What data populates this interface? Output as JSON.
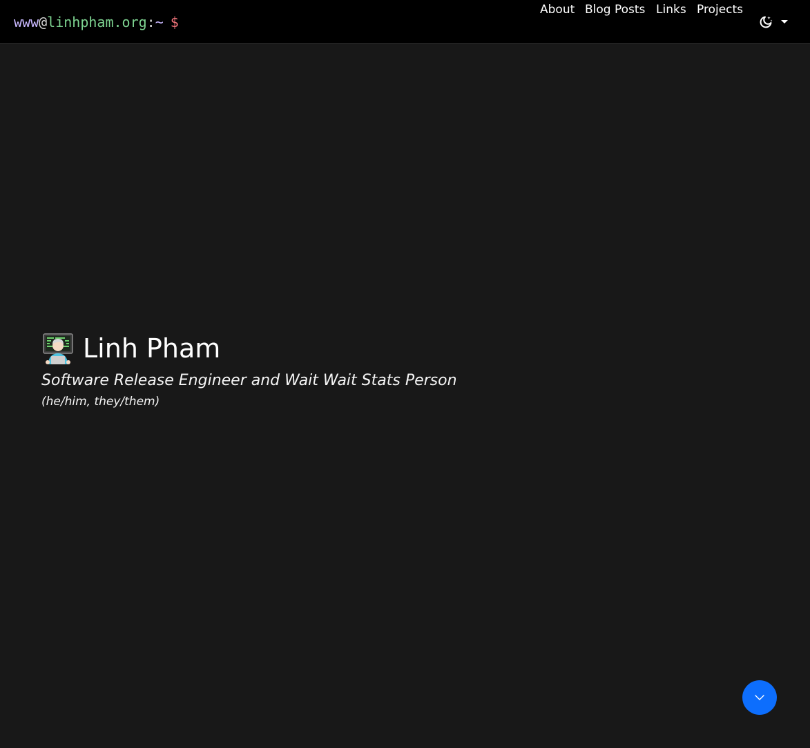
{
  "navbar": {
    "brand": {
      "user": "www",
      "at": "@",
      "host": "linhpham.org",
      "colon": ":",
      "tilde": "~",
      "prompt": "$"
    },
    "links": [
      {
        "label": "About"
      },
      {
        "label": "Blog Posts"
      },
      {
        "label": "Links"
      },
      {
        "label": "Projects"
      }
    ],
    "theme_toggle": {
      "icon": "moon-stars-icon",
      "caret": "caret-down-icon"
    }
  },
  "hero": {
    "emoji": "technologist-emoji",
    "name": "Linh Pham",
    "subtitle": "Software Release Engineer and Wait Wait Stats Person",
    "pronouns": "(he/him, they/them)"
  },
  "scroll_button": {
    "icon": "chevron-down-icon"
  },
  "colors": {
    "background": "#181818",
    "navbar": "#000000",
    "brand_user": "#c9b8ff",
    "brand_host": "#7ed491",
    "brand_prompt": "#f0747a",
    "accent": "#0d6efd"
  }
}
